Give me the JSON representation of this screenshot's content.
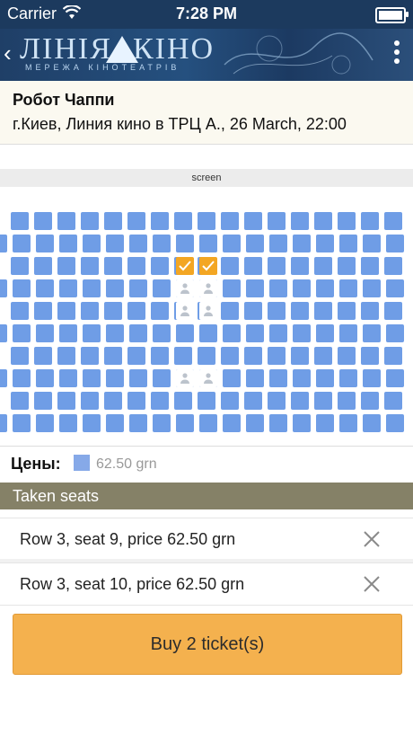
{
  "status_bar": {
    "carrier": "Carrier",
    "time": "7:28 PM"
  },
  "header": {
    "logo_title_left": "ЛІНІЯ",
    "logo_title_right": "КІНО",
    "logo_subtitle": "МЕРЕЖА КІНОТЕАТРІВ"
  },
  "movie": {
    "title": "Робот Чаппи",
    "details": "г.Киев, Линия кино в ТРЦ А., 26 March, 22:00"
  },
  "screen_label": "screen",
  "seat_map": {
    "seat_color": "#6f9de6",
    "selected_color": "#f3a623",
    "rows": 10,
    "selected_seats": [
      {
        "row": 3,
        "seat": 9
      },
      {
        "row": 3,
        "seat": 10
      }
    ]
  },
  "prices": {
    "label": "Цены:",
    "value": "62.50 grn"
  },
  "taken_seats": {
    "header": "Taken seats",
    "items": [
      {
        "text": "Row 3, seat 9, price 62.50 grn"
      },
      {
        "text": "Row 3, seat 10, price 62.50 grn"
      }
    ]
  },
  "buy_button": {
    "label": "Buy 2 ticket(s)",
    "color": "#f4b14e"
  }
}
